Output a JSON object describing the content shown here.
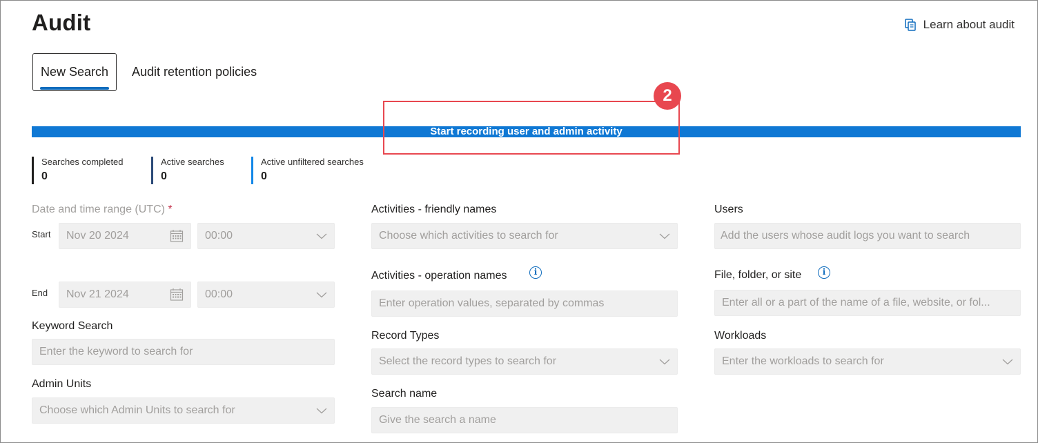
{
  "header": {
    "title": "Audit",
    "learn_link": "Learn about audit"
  },
  "tabs": [
    {
      "label": "New Search",
      "selected": true
    },
    {
      "label": "Audit retention policies",
      "selected": false
    }
  ],
  "banner": {
    "label": "Start recording user and admin activity",
    "color": "#0f78d4"
  },
  "annotation": {
    "badge": "2",
    "color": "#e8474f"
  },
  "stats": [
    {
      "label": "Searches completed",
      "value": "0"
    },
    {
      "label": "Active searches",
      "value": "0"
    },
    {
      "label": "Active unfiltered searches",
      "value": "0"
    }
  ],
  "form": {
    "date_range": {
      "label": "Date and time range (UTC)",
      "required_mark": "*",
      "start_label": "Start",
      "start_date": "Nov 20 2024",
      "start_time": "00:00",
      "end_label": "End",
      "end_date": "Nov 21 2024",
      "end_time": "00:00"
    },
    "keyword": {
      "label": "Keyword Search",
      "placeholder": "Enter the keyword to search for"
    },
    "admin_units": {
      "label": "Admin Units",
      "placeholder": "Choose which Admin Units to search for"
    },
    "activities_friendly": {
      "label": "Activities - friendly names",
      "placeholder": "Choose which activities to search for"
    },
    "activities_operation": {
      "label": "Activities - operation names",
      "placeholder": "Enter operation values, separated by commas"
    },
    "record_types": {
      "label": "Record Types",
      "placeholder": "Select the record types to search for"
    },
    "search_name": {
      "label": "Search name",
      "placeholder": "Give the search a name"
    },
    "users": {
      "label": "Users",
      "placeholder": "Add the users whose audit logs you want to search"
    },
    "file_folder_site": {
      "label": "File, folder, or site",
      "placeholder": "Enter all or a part of the name of a file, website, or fol..."
    },
    "workloads": {
      "label": "Workloads",
      "placeholder": "Enter the workloads to search for"
    }
  },
  "icons": {
    "learn": "document-copy-icon",
    "calendar": "calendar-icon",
    "chevron": "chevron-down-icon",
    "info": "info-icon"
  }
}
